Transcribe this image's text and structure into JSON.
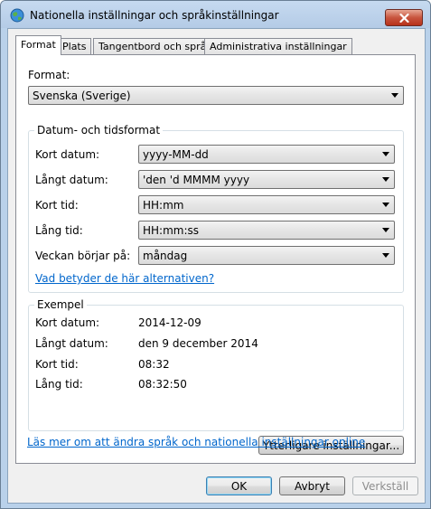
{
  "window": {
    "title": "Nationella inställningar och språkinställningar"
  },
  "tabs": [
    {
      "label": "Format"
    },
    {
      "label": "Plats"
    },
    {
      "label": "Tangentbord och språk"
    },
    {
      "label": "Administrativa inställningar"
    }
  ],
  "format": {
    "label": "Format:",
    "selected": "Svenska (Sverige)"
  },
  "datetime": {
    "title": "Datum- och tidsformat",
    "short_date": {
      "label": "Kort datum:",
      "value": "yyyy-MM-dd"
    },
    "long_date": {
      "label": "Långt datum:",
      "value": "'den 'd MMMM yyyy"
    },
    "short_time": {
      "label": "Kort tid:",
      "value": "HH:mm"
    },
    "long_time": {
      "label": "Lång tid:",
      "value": "HH:mm:ss"
    },
    "first_day": {
      "label": "Veckan börjar på:",
      "value": "måndag"
    },
    "help_link": "Vad betyder de här alternativen?"
  },
  "example": {
    "title": "Exempel",
    "rows": [
      {
        "label": "Kort datum:",
        "value": "2014-12-09"
      },
      {
        "label": "Långt datum:",
        "value": "den 9 december 2014"
      },
      {
        "label": "Kort tid:",
        "value": "08:32"
      },
      {
        "label": "Lång tid:",
        "value": "08:32:50"
      }
    ]
  },
  "additional_button": "Ytterligare inställningar...",
  "online_link": "Läs mer om att ändra språk och nationella inställningar online",
  "buttons": {
    "ok": "OK",
    "cancel": "Avbryt",
    "apply": "Verkställ"
  }
}
